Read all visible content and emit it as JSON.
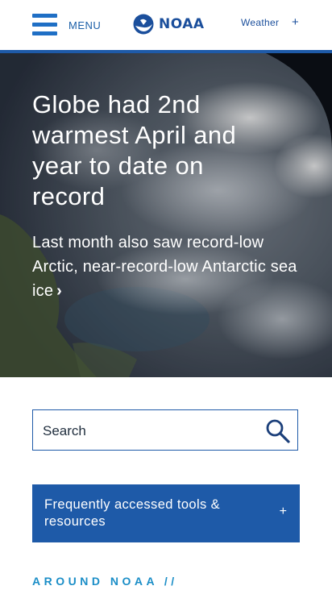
{
  "header": {
    "menu_label": "MENU",
    "logo_text": "NOAA",
    "weather_label": "Weather",
    "weather_expand": "+"
  },
  "hero": {
    "title": "Globe had 2nd warmest April and year to date on record",
    "subtitle": "Last month also saw record-low Arctic, near-record-low Antarctic sea ice",
    "subtitle_chevron": "›"
  },
  "search": {
    "placeholder": "Search"
  },
  "tools": {
    "label": "Frequently accessed tools & resources",
    "expand": "+"
  },
  "around": {
    "label": "AROUND NOAA //"
  },
  "colors": {
    "brand_blue": "#1e5aa8",
    "accent_light_blue": "#1b8ec7",
    "hero_text": "#ffffff"
  }
}
